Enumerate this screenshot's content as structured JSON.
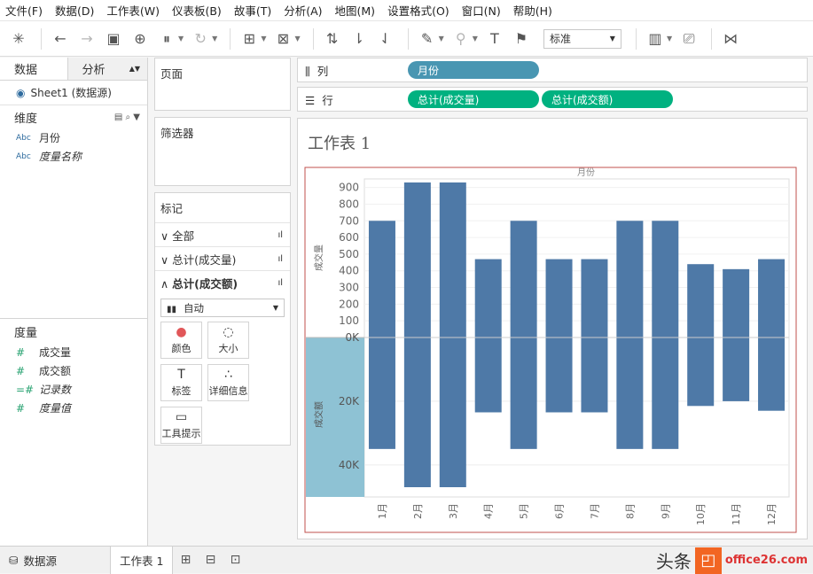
{
  "menu": [
    "文件(F)",
    "数据(D)",
    "工作表(W)",
    "仪表板(B)",
    "故事(T)",
    "分析(A)",
    "地图(M)",
    "设置格式(O)",
    "窗口(N)",
    "帮助(H)"
  ],
  "toolbar": {
    "fit_select": "标准"
  },
  "left_panel": {
    "tabs": {
      "data": "数据",
      "analytics": "分析"
    },
    "datasource": "Sheet1 (数据源)",
    "dimensions_title": "维度",
    "dimensions": [
      {
        "type": "Abc",
        "name": "月份"
      },
      {
        "type": "Abc",
        "name": "度量名称"
      }
    ],
    "measures_title": "度量",
    "measures": [
      {
        "type": "#",
        "name": "成交量"
      },
      {
        "type": "#",
        "name": "成交额"
      },
      {
        "type": "=#",
        "name": "记录数"
      },
      {
        "type": "#",
        "name": "度量值"
      }
    ]
  },
  "cards": {
    "pages": "页面",
    "filters": "筛选器",
    "marks": "标记",
    "mark_rows": [
      "全部",
      "总计(成交量)",
      "总计(成交额)"
    ],
    "mark_type": "自动",
    "props": [
      "颜色",
      "大小",
      "标签",
      "详细信息",
      "工具提示"
    ]
  },
  "shelves": {
    "columns_label": "列",
    "rows_label": "行",
    "column_pills": [
      "月份"
    ],
    "row_pills": [
      "总计(成交量)",
      "总计(成交额)"
    ]
  },
  "sheet": {
    "title": "工作表 1"
  },
  "chart_data": {
    "type": "bar",
    "header": "月份",
    "categories": [
      "1月",
      "2月",
      "3月",
      "4月",
      "5月",
      "6月",
      "7月",
      "8月",
      "9月",
      "10月",
      "11月",
      "12月"
    ],
    "series": [
      {
        "name": "成交量",
        "values": [
          700,
          930,
          930,
          470,
          700,
          470,
          470,
          700,
          700,
          440,
          410,
          470
        ],
        "ylim": [
          0,
          930
        ],
        "ticks": [
          "100",
          "200",
          "300",
          "400",
          "500",
          "600",
          "700",
          "800",
          "900"
        ],
        "tick_values": [
          100,
          200,
          300,
          400,
          500,
          600,
          700,
          800,
          900
        ]
      },
      {
        "name": "成交额",
        "values": [
          35000,
          47000,
          47000,
          23500,
          35000,
          23500,
          23500,
          35000,
          35000,
          21500,
          20000,
          23000
        ],
        "ylim": [
          0,
          47000
        ],
        "ticks": [
          "0K",
          "20K",
          "40K"
        ],
        "tick_values": [
          0,
          20000,
          40000
        ]
      }
    ],
    "bar_color": "#4e79a7"
  },
  "status": {
    "datasource": "数据源",
    "sheet_tab": "工作表 1"
  },
  "watermark": {
    "text_left": "头条",
    "text_right": "office26.com"
  }
}
